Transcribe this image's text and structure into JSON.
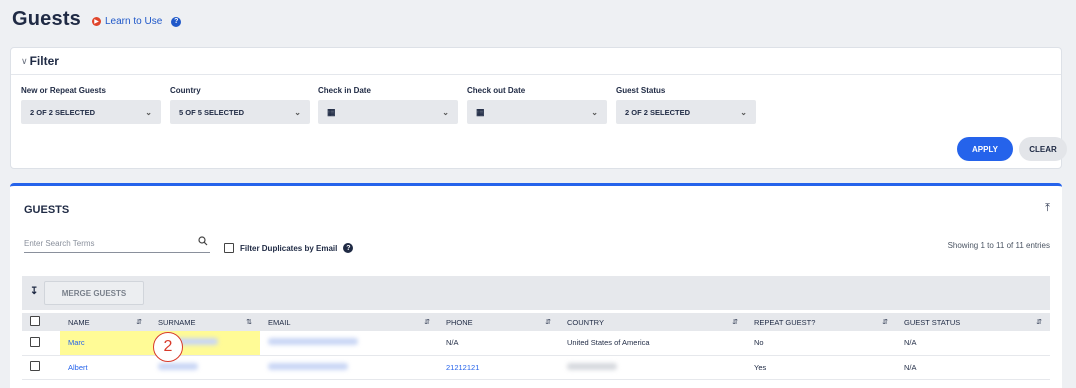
{
  "header": {
    "title": "Guests",
    "learn_label": "Learn to Use",
    "help_glyph": "?"
  },
  "filter": {
    "title": "Filter",
    "groups": [
      {
        "label": "New or Repeat Guests",
        "value": "2 OF 2 SELECTED"
      },
      {
        "label": "Country",
        "value": "5 OF 5 SELECTED"
      },
      {
        "label": "Check in Date",
        "value": ""
      },
      {
        "label": "Check out Date",
        "value": ""
      },
      {
        "label": "Guest Status",
        "value": "2 OF 2 SELECTED"
      }
    ],
    "apply_label": "APPLY",
    "clear_label": "CLEAR"
  },
  "guests": {
    "title": "GUESTS",
    "search_placeholder": "Enter Search Terms",
    "dup_label": "Filter Duplicates by Email",
    "showing": "Showing 1 to 11 of 11 entries",
    "merge_label": "MERGE GUESTS",
    "columns": [
      "NAME",
      "SURNAME",
      "EMAIL",
      "PHONE",
      "COUNTRY",
      "REPEAT GUEST?",
      "GUEST STATUS"
    ],
    "rows": [
      {
        "name": "Marc",
        "phone": "N/A",
        "country": "United States of America",
        "repeat": "No",
        "status": "N/A"
      },
      {
        "name": "Albert",
        "phone": "21212121",
        "country": "",
        "repeat": "Yes",
        "status": "N/A"
      }
    ]
  },
  "annotation": {
    "marker": "2"
  },
  "colors": {
    "accent": "#2563eb",
    "highlight": "#fffb96",
    "marker": "#d83a2a"
  }
}
